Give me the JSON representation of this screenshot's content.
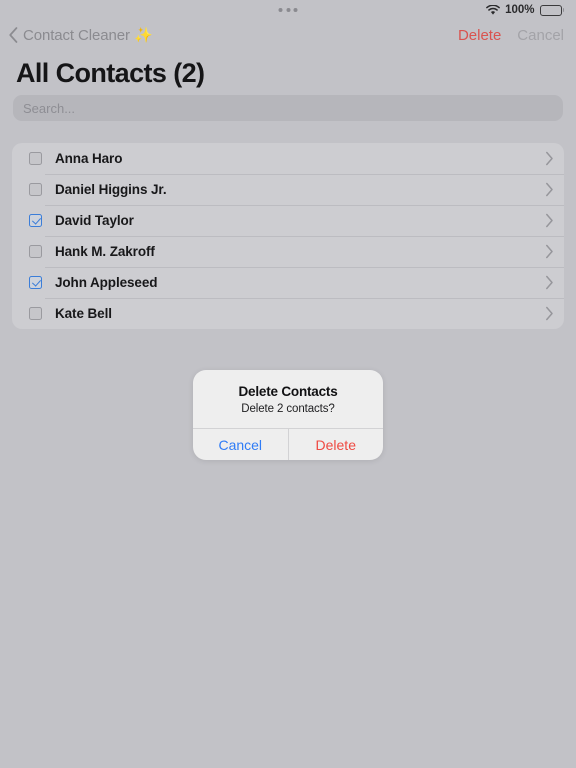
{
  "status_bar": {
    "wifi_icon": "wifi-icon",
    "battery_percent": "100%",
    "battery_icon": "battery-full-icon",
    "multitask_icon": "multitask-dots-icon"
  },
  "nav_bar": {
    "back_icon": "chevron-left-icon",
    "back_label": "Contact Cleaner ✨",
    "delete_label": "Delete",
    "cancel_label": "Cancel",
    "delete_color": "#d9534f",
    "cancel_color": "#a3a3a8"
  },
  "page": {
    "title": "All Contacts (2)"
  },
  "search": {
    "placeholder": "Search...",
    "value": ""
  },
  "contacts": [
    {
      "name": "Anna Haro",
      "checked": false,
      "disclosure_icon": "chevron-right-icon"
    },
    {
      "name": "Daniel Higgins Jr.",
      "checked": false,
      "disclosure_icon": "chevron-right-icon"
    },
    {
      "name": "David Taylor",
      "checked": true,
      "disclosure_icon": "chevron-right-icon"
    },
    {
      "name": "Hank M. Zakroff",
      "checked": false,
      "disclosure_icon": "chevron-right-icon"
    },
    {
      "name": "John Appleseed",
      "checked": true,
      "disclosure_icon": "chevron-right-icon"
    },
    {
      "name": "Kate Bell",
      "checked": false,
      "disclosure_icon": "chevron-right-icon"
    }
  ],
  "alert": {
    "title": "Delete Contacts",
    "message": "Delete 2 contacts?",
    "cancel_label": "Cancel",
    "delete_label": "Delete",
    "cancel_color": "#2f7cf6",
    "delete_color": "#ef4a42"
  },
  "colors": {
    "background": "#c2c2c7",
    "list_background": "#cdcdd1",
    "accent_blue": "#3b7dd8",
    "destructive_red": "#d9534f"
  }
}
